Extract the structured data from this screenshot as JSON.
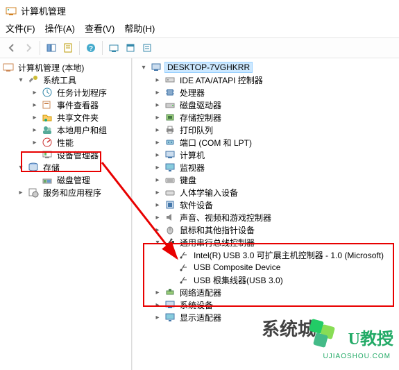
{
  "window": {
    "title": "计算机管理"
  },
  "menu": {
    "file": "文件(F)",
    "action": "操作(A)",
    "view": "查看(V)",
    "help": "帮助(H)"
  },
  "left_tree": {
    "root": "计算机管理 (本地)",
    "sys_tools": "系统工具",
    "task_scheduler": "任务计划程序",
    "event_viewer": "事件查看器",
    "shared_folders": "共享文件夹",
    "local_users": "本地用户和组",
    "performance": "性能",
    "device_manager": "设备管理器",
    "storage": "存储",
    "disk_mgmt": "磁盘管理",
    "services_apps": "服务和应用程序"
  },
  "right_tree": {
    "computer": "DESKTOP-7VGHKRR",
    "ide": "IDE ATA/ATAPI 控制器",
    "cpu": "处理器",
    "disk_drives": "磁盘驱动器",
    "storage_ctrl": "存储控制器",
    "print_queues": "打印队列",
    "ports": "端口 (COM 和 LPT)",
    "computers": "计算机",
    "monitors": "监视器",
    "keyboards": "键盘",
    "hid": "人体学输入设备",
    "sw_devices": "软件设备",
    "sound": "声音、视频和游戏控制器",
    "mice": "鼠标和其他指针设备",
    "usb_ctrl": "通用串行总线控制器",
    "usb_item1": "Intel(R) USB 3.0 可扩展主机控制器 - 1.0 (Microsoft)",
    "usb_item2": "USB Composite Device",
    "usb_item3": "USB 根集线器(USB 3.0)",
    "net_adapters": "网络适配器",
    "sys_devices": "系统设备",
    "display_adapters": "显示适配器"
  },
  "watermark": {
    "brand1": "系统城",
    "brand2": "U教授",
    "sub": "UJIAOSHOU.COM"
  }
}
